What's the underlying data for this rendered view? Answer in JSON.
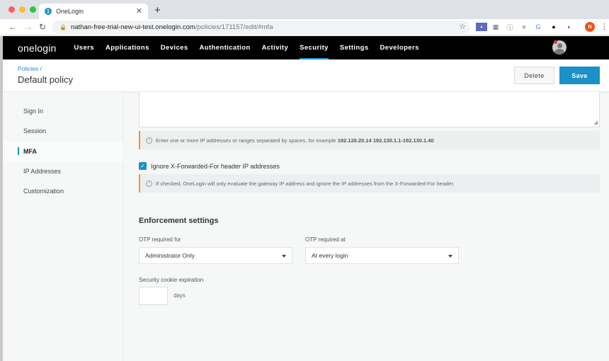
{
  "browser": {
    "tab_title": "OneLogin",
    "tab_favicon": "1",
    "url_host": "nathan-free-trial-new-ui-test.onelogin.com",
    "url_path": "/policies/171157/edit/#mfa",
    "profile_initial": "N",
    "extensions": [
      "santa-ext-icon",
      "layout-ext-icon",
      "info-ext-icon",
      "square-ext-icon",
      "translate-ext-icon",
      "dark-ext-icon",
      "purple-ext-icon"
    ]
  },
  "nav": {
    "logo": "onelogin",
    "items": [
      "Users",
      "Applications",
      "Devices",
      "Authentication",
      "Activity",
      "Security",
      "Settings",
      "Developers"
    ],
    "active": "Security"
  },
  "header": {
    "breadcrumb": "Policies /",
    "title": "Default policy",
    "delete_label": "Delete",
    "save_label": "Save"
  },
  "sidebar": {
    "items": [
      {
        "label": "Sign In"
      },
      {
        "label": "Session"
      },
      {
        "label": "MFA"
      },
      {
        "label": "IP Addresses"
      },
      {
        "label": "Customization"
      }
    ],
    "active": "MFA"
  },
  "main": {
    "ip_textarea_value": "",
    "ip_hint": "Enter one or more IP addresses or ranges separated by spaces, for example",
    "ip_hint_example": "192.128.20.14 192.130.1.1-192.130.1.40",
    "ignore_xff_label": "Ignore X-Forwarded-For header IP addresses",
    "ignore_xff_checked": true,
    "ignore_xff_hint": "If checked, OneLogin will only evaluate the gateway IP address and ignore the IP addresses from the X-Forwarded-For header.",
    "enforcement_title": "Enforcement settings",
    "otp_for_label": "OTP required for",
    "otp_for_value": "Administrator Only",
    "otp_at_label": "OTP required at",
    "otp_at_value": "At every login",
    "cookie_label": "Security cookie expiration",
    "cookie_value": "",
    "cookie_unit": "days"
  },
  "colors": {
    "accent": "#1a91c8",
    "warning_border": "#f0932b",
    "nav_bg": "#000000"
  }
}
